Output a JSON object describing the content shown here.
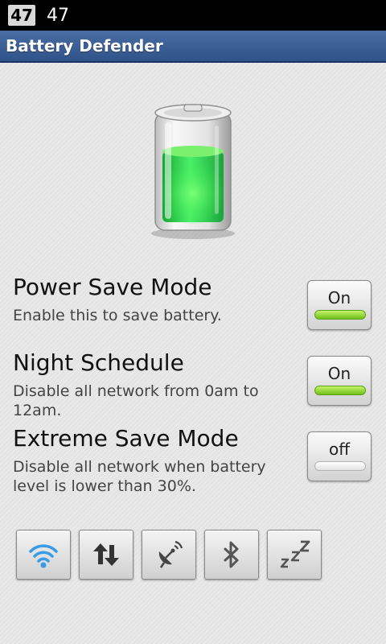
{
  "status_bar": {
    "badge": "47",
    "value": "47"
  },
  "app": {
    "title": "Battery Defender"
  },
  "settings": [
    {
      "title": "Power Save Mode",
      "description": "Enable this to save battery.",
      "toggle": "On"
    },
    {
      "title": "Night Schedule",
      "description": "Disable all network from 0am to 12am.",
      "toggle": "On"
    },
    {
      "title": "Extreme Save Mode",
      "description": "Disable all network when battery level is lower than 30%.",
      "toggle": "off"
    }
  ],
  "quick_toggles": [
    "wifi-icon",
    "data-transfer-icon",
    "gps-icon",
    "bluetooth-icon",
    "sleep-icon"
  ],
  "colors": {
    "title_bar": "#2f5288",
    "toggle_on": "#6fc21a",
    "battery_fill": "#2ee84a",
    "wifi_active": "#3a9be6"
  }
}
